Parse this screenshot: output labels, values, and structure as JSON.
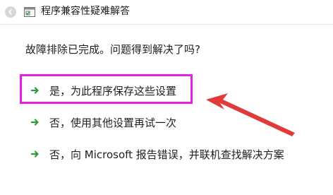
{
  "window": {
    "title": "程序兼容性疑难解答"
  },
  "main": {
    "question": "故障排除已完成。问题得到解决了吗?",
    "options": [
      {
        "label": "是，为此程序保存这些设置"
      },
      {
        "label": "否，使用其他设置再试一次"
      },
      {
        "label": "否，向 Microsoft 报告错误，并联机查找解决方案"
      }
    ]
  },
  "icons": {
    "back": "back-arrow-icon",
    "app": "compatibility-troubleshooter-icon",
    "option_arrow": "green-arrow-icon"
  },
  "colors": {
    "highlight": "#e41fe0",
    "annotation_arrow": "#e03a3a",
    "option_arrow": "#2e9a3a"
  }
}
